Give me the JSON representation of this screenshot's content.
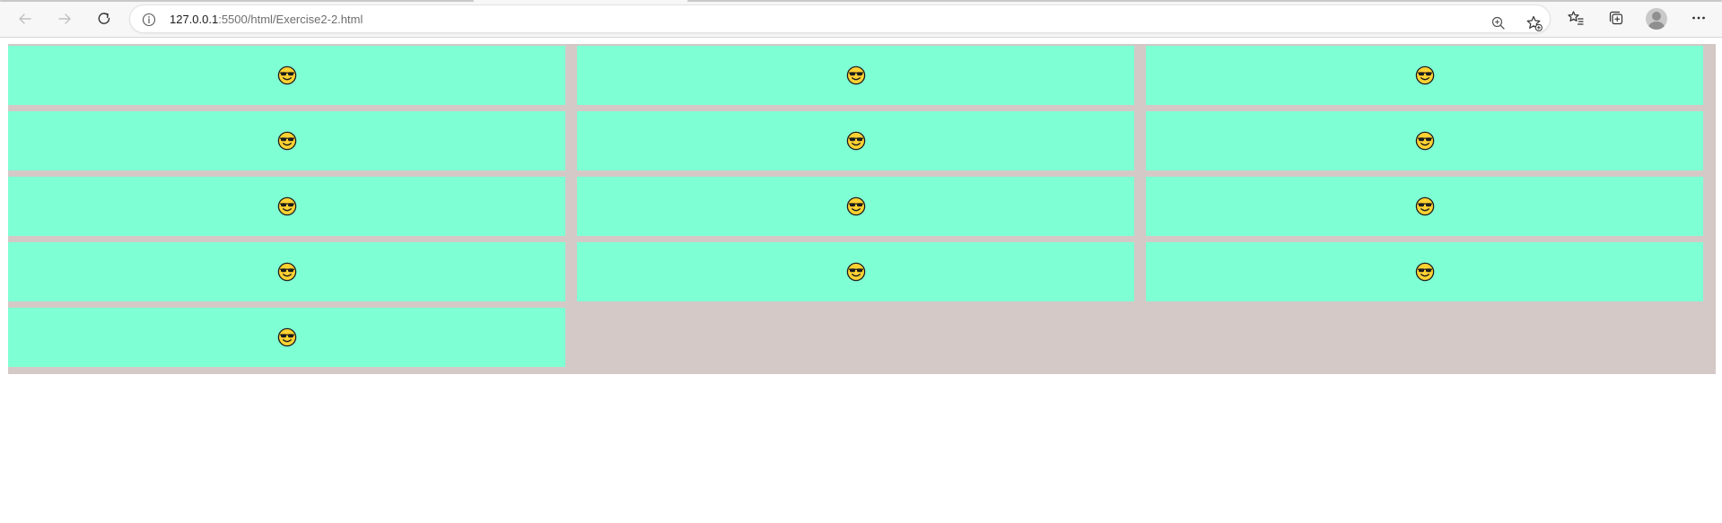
{
  "browser": {
    "url_host": "127.0.0.1",
    "url_path": ":5500/html/Exercise2-2.html",
    "back_icon": "arrow-left-icon",
    "forward_icon": "arrow-right-icon",
    "refresh_icon": "refresh-icon",
    "site_info_icon": "info-icon",
    "zoom_icon": "zoom-in-icon",
    "add_favorite_icon": "star-add-icon",
    "favorites_icon": "favorites-list-icon",
    "collections_icon": "collections-icon",
    "profile_icon": "profile-avatar-icon",
    "menu_icon": "more-horizontal-icon"
  },
  "page": {
    "background_color": "#d4c9c7",
    "cell_color": "#7fffd4",
    "cells": [
      {
        "icon": "smiling-face-with-sunglasses-icon"
      },
      {
        "icon": "smiling-face-with-sunglasses-icon"
      },
      {
        "icon": "smiling-face-with-sunglasses-icon"
      },
      {
        "icon": "smiling-face-with-sunglasses-icon"
      },
      {
        "icon": "smiling-face-with-sunglasses-icon"
      },
      {
        "icon": "smiling-face-with-sunglasses-icon"
      },
      {
        "icon": "smiling-face-with-sunglasses-icon"
      },
      {
        "icon": "smiling-face-with-sunglasses-icon"
      },
      {
        "icon": "smiling-face-with-sunglasses-icon"
      },
      {
        "icon": "smiling-face-with-sunglasses-icon"
      },
      {
        "icon": "smiling-face-with-sunglasses-icon"
      },
      {
        "icon": "smiling-face-with-sunglasses-icon"
      },
      {
        "icon": "smiling-face-with-sunglasses-icon"
      }
    ]
  }
}
